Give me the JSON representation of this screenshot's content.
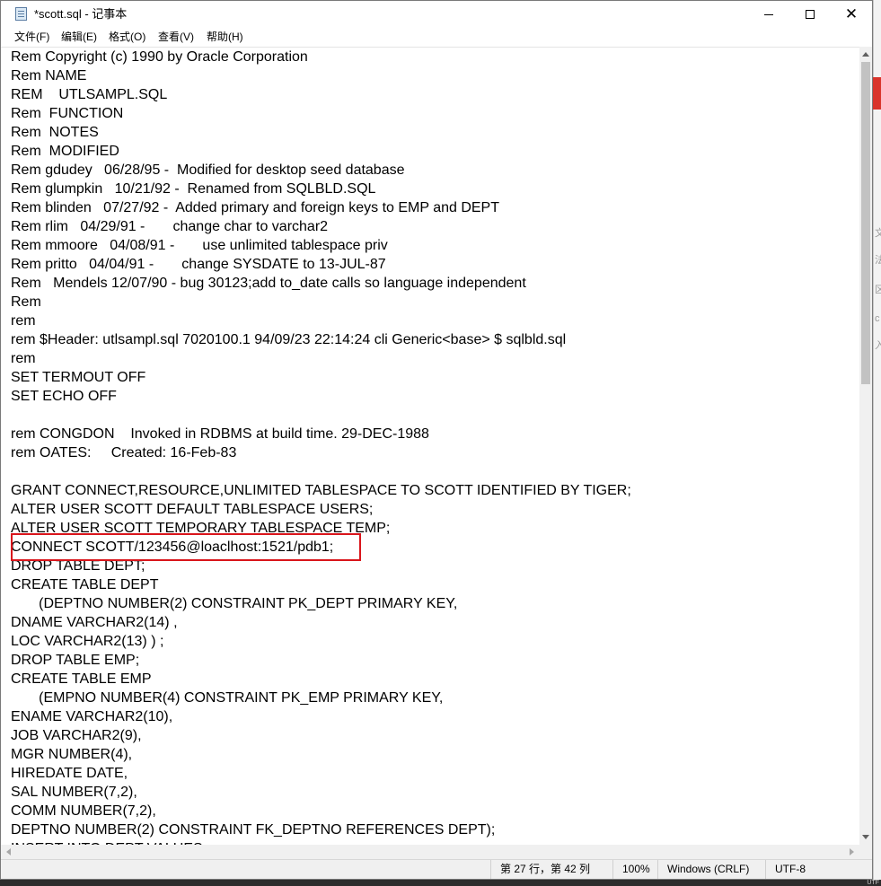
{
  "window": {
    "title": "*scott.sql - 记事本",
    "icon": "notepad-icon",
    "controls": {
      "minimize": "minimize-icon",
      "maximize": "maximize-icon",
      "close": "close-icon"
    }
  },
  "menu": [
    {
      "label": "文件(F)"
    },
    {
      "label": "编辑(E)"
    },
    {
      "label": "格式(O)"
    },
    {
      "label": "查看(V)"
    },
    {
      "label": "帮助(H)"
    }
  ],
  "editor": {
    "lines": [
      "Rem Copyright (c) 1990 by Oracle Corporation",
      "Rem NAME",
      "REM    UTLSAMPL.SQL",
      "Rem  FUNCTION",
      "Rem  NOTES",
      "Rem  MODIFIED",
      "Rem gdudey   06/28/95 -  Modified for desktop seed database",
      "Rem glumpkin   10/21/92 -  Renamed from SQLBLD.SQL",
      "Rem blinden   07/27/92 -  Added primary and foreign keys to EMP and DEPT",
      "Rem rlim   04/29/91 -       change char to varchar2",
      "Rem mmoore   04/08/91 -       use unlimited tablespace priv",
      "Rem pritto   04/04/91 -       change SYSDATE to 13-JUL-87",
      "Rem   Mendels 12/07/90 - bug 30123;add to_date calls so language independent",
      "Rem",
      "rem",
      "rem $Header: utlsampl.sql 7020100.1 94/09/23 22:14:24 cli Generic<base> $ sqlbld.sql",
      "rem",
      "SET TERMOUT OFF",
      "SET ECHO OFF",
      "",
      "rem CONGDON    Invoked in RDBMS at build time. 29-DEC-1988",
      "rem OATES:     Created: 16-Feb-83",
      "",
      "GRANT CONNECT,RESOURCE,UNLIMITED TABLESPACE TO SCOTT IDENTIFIED BY TIGER;",
      "ALTER USER SCOTT DEFAULT TABLESPACE USERS;",
      "ALTER USER SCOTT TEMPORARY TABLESPACE TEMP;",
      "CONNECT SCOTT/123456@loaclhost:1521/pdb1;",
      "DROP TABLE DEPT;",
      "CREATE TABLE DEPT",
      "       (DEPTNO NUMBER(2) CONSTRAINT PK_DEPT PRIMARY KEY,",
      "DNAME VARCHAR2(14) ,",
      "LOC VARCHAR2(13) ) ;",
      "DROP TABLE EMP;",
      "CREATE TABLE EMP",
      "       (EMPNO NUMBER(4) CONSTRAINT PK_EMP PRIMARY KEY,",
      "ENAME VARCHAR2(10),",
      "JOB VARCHAR2(9),",
      "MGR NUMBER(4),",
      "HIREDATE DATE,",
      "SAL NUMBER(7,2),",
      "COMM NUMBER(7,2),",
      "DEPTNO NUMBER(2) CONSTRAINT FK_DEPTNO REFERENCES DEPT);",
      "INSERT INTO DEPT VALUES"
    ],
    "highlight_color": "#d9151b"
  },
  "statusbar": {
    "position": "第 27 行，第 42 列",
    "zoom": "100%",
    "line_ending": "Windows (CRLF)",
    "encoding": "UTF-8"
  },
  "background": {
    "glyphs": [
      "文",
      "法",
      "区",
      "c",
      "入"
    ],
    "bottom_text": "UTF"
  }
}
